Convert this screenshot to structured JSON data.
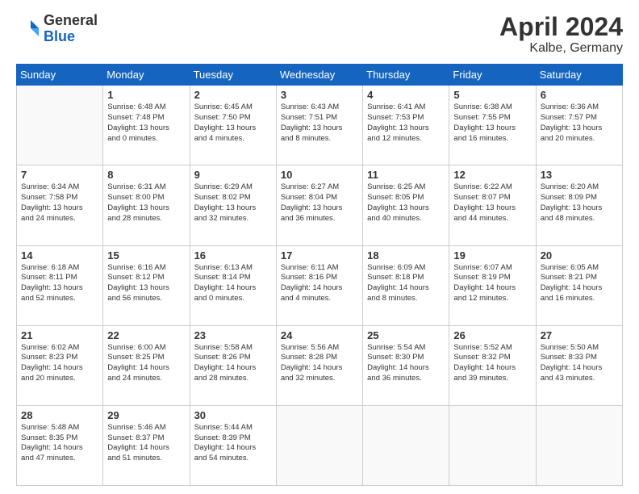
{
  "header": {
    "logo_general": "General",
    "logo_blue": "Blue",
    "month_title": "April 2024",
    "location": "Kalbe, Germany"
  },
  "days_of_week": [
    "Sunday",
    "Monday",
    "Tuesday",
    "Wednesday",
    "Thursday",
    "Friday",
    "Saturday"
  ],
  "weeks": [
    [
      {
        "day": "",
        "info": ""
      },
      {
        "day": "1",
        "info": "Sunrise: 6:48 AM\nSunset: 7:48 PM\nDaylight: 13 hours\nand 0 minutes."
      },
      {
        "day": "2",
        "info": "Sunrise: 6:45 AM\nSunset: 7:50 PM\nDaylight: 13 hours\nand 4 minutes."
      },
      {
        "day": "3",
        "info": "Sunrise: 6:43 AM\nSunset: 7:51 PM\nDaylight: 13 hours\nand 8 minutes."
      },
      {
        "day": "4",
        "info": "Sunrise: 6:41 AM\nSunset: 7:53 PM\nDaylight: 13 hours\nand 12 minutes."
      },
      {
        "day": "5",
        "info": "Sunrise: 6:38 AM\nSunset: 7:55 PM\nDaylight: 13 hours\nand 16 minutes."
      },
      {
        "day": "6",
        "info": "Sunrise: 6:36 AM\nSunset: 7:57 PM\nDaylight: 13 hours\nand 20 minutes."
      }
    ],
    [
      {
        "day": "7",
        "info": "Sunrise: 6:34 AM\nSunset: 7:58 PM\nDaylight: 13 hours\nand 24 minutes."
      },
      {
        "day": "8",
        "info": "Sunrise: 6:31 AM\nSunset: 8:00 PM\nDaylight: 13 hours\nand 28 minutes."
      },
      {
        "day": "9",
        "info": "Sunrise: 6:29 AM\nSunset: 8:02 PM\nDaylight: 13 hours\nand 32 minutes."
      },
      {
        "day": "10",
        "info": "Sunrise: 6:27 AM\nSunset: 8:04 PM\nDaylight: 13 hours\nand 36 minutes."
      },
      {
        "day": "11",
        "info": "Sunrise: 6:25 AM\nSunset: 8:05 PM\nDaylight: 13 hours\nand 40 minutes."
      },
      {
        "day": "12",
        "info": "Sunrise: 6:22 AM\nSunset: 8:07 PM\nDaylight: 13 hours\nand 44 minutes."
      },
      {
        "day": "13",
        "info": "Sunrise: 6:20 AM\nSunset: 8:09 PM\nDaylight: 13 hours\nand 48 minutes."
      }
    ],
    [
      {
        "day": "14",
        "info": "Sunrise: 6:18 AM\nSunset: 8:11 PM\nDaylight: 13 hours\nand 52 minutes."
      },
      {
        "day": "15",
        "info": "Sunrise: 6:16 AM\nSunset: 8:12 PM\nDaylight: 13 hours\nand 56 minutes."
      },
      {
        "day": "16",
        "info": "Sunrise: 6:13 AM\nSunset: 8:14 PM\nDaylight: 14 hours\nand 0 minutes."
      },
      {
        "day": "17",
        "info": "Sunrise: 6:11 AM\nSunset: 8:16 PM\nDaylight: 14 hours\nand 4 minutes."
      },
      {
        "day": "18",
        "info": "Sunrise: 6:09 AM\nSunset: 8:18 PM\nDaylight: 14 hours\nand 8 minutes."
      },
      {
        "day": "19",
        "info": "Sunrise: 6:07 AM\nSunset: 8:19 PM\nDaylight: 14 hours\nand 12 minutes."
      },
      {
        "day": "20",
        "info": "Sunrise: 6:05 AM\nSunset: 8:21 PM\nDaylight: 14 hours\nand 16 minutes."
      }
    ],
    [
      {
        "day": "21",
        "info": "Sunrise: 6:02 AM\nSunset: 8:23 PM\nDaylight: 14 hours\nand 20 minutes."
      },
      {
        "day": "22",
        "info": "Sunrise: 6:00 AM\nSunset: 8:25 PM\nDaylight: 14 hours\nand 24 minutes."
      },
      {
        "day": "23",
        "info": "Sunrise: 5:58 AM\nSunset: 8:26 PM\nDaylight: 14 hours\nand 28 minutes."
      },
      {
        "day": "24",
        "info": "Sunrise: 5:56 AM\nSunset: 8:28 PM\nDaylight: 14 hours\nand 32 minutes."
      },
      {
        "day": "25",
        "info": "Sunrise: 5:54 AM\nSunset: 8:30 PM\nDaylight: 14 hours\nand 36 minutes."
      },
      {
        "day": "26",
        "info": "Sunrise: 5:52 AM\nSunset: 8:32 PM\nDaylight: 14 hours\nand 39 minutes."
      },
      {
        "day": "27",
        "info": "Sunrise: 5:50 AM\nSunset: 8:33 PM\nDaylight: 14 hours\nand 43 minutes."
      }
    ],
    [
      {
        "day": "28",
        "info": "Sunrise: 5:48 AM\nSunset: 8:35 PM\nDaylight: 14 hours\nand 47 minutes."
      },
      {
        "day": "29",
        "info": "Sunrise: 5:46 AM\nSunset: 8:37 PM\nDaylight: 14 hours\nand 51 minutes."
      },
      {
        "day": "30",
        "info": "Sunrise: 5:44 AM\nSunset: 8:39 PM\nDaylight: 14 hours\nand 54 minutes."
      },
      {
        "day": "",
        "info": ""
      },
      {
        "day": "",
        "info": ""
      },
      {
        "day": "",
        "info": ""
      },
      {
        "day": "",
        "info": ""
      }
    ]
  ]
}
